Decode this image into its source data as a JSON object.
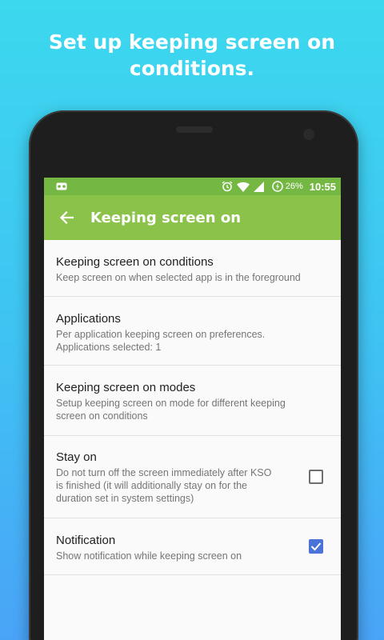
{
  "promo": {
    "headline_line1": "Set up keeping screen on",
    "headline_line2": "conditions."
  },
  "statusbar": {
    "notification_icon": "voicemail-icon",
    "alarm_icon": "alarm-icon",
    "wifi_icon": "wifi-icon",
    "signal_icon": "cell-signal-icon",
    "battery_icon": "battery-charging-icon",
    "battery": "26%",
    "time": "10:55"
  },
  "toolbar": {
    "back_icon": "arrow-back-icon",
    "title": "Keeping screen on"
  },
  "preferences": [
    {
      "title": "Keeping screen on conditions",
      "summary": [
        "Keep screen on when selected app is in the foreground"
      ]
    },
    {
      "title": "Applications",
      "summary": [
        "Per application keeping screen on preferences.",
        "Applications selected: 1"
      ]
    },
    {
      "title": "Keeping screen on modes",
      "summary": [
        "Setup keeping screen on mode for different keeping",
        "screen on conditions"
      ]
    },
    {
      "title": "Stay on",
      "summary": [
        "Do not turn off the screen immediately after KSO",
        "is finished (it will additionally stay on for the",
        "duration set in system settings)"
      ],
      "checked": false
    },
    {
      "title": "Notification",
      "summary": [
        "Show notification while keeping screen on"
      ],
      "checked": true
    }
  ],
  "colors": {
    "status_bar": "#74b843",
    "app_bar": "#8bc34a",
    "checkbox_accent": "#4a72d9"
  }
}
